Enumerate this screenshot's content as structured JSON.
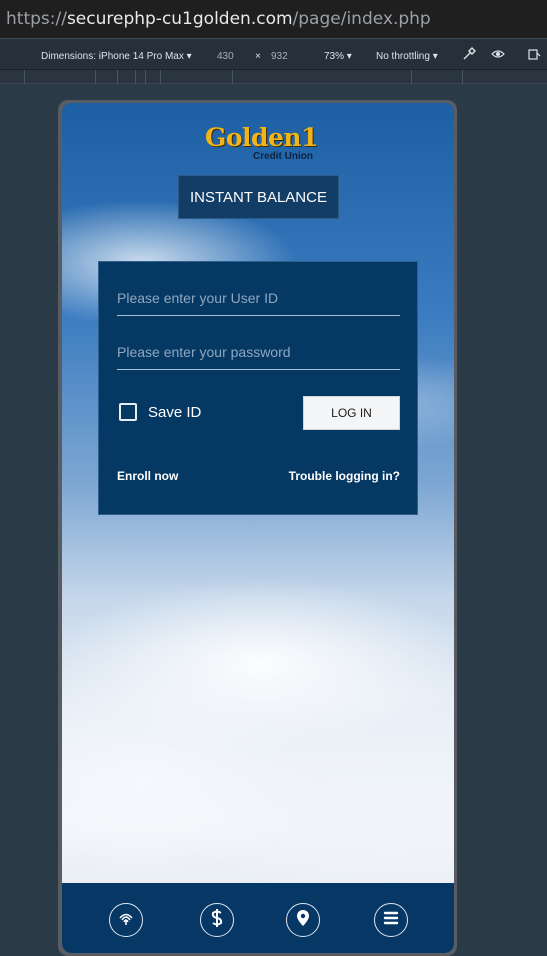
{
  "browser": {
    "url_scheme": "https://",
    "url_host": "securephp-cu1golden.com",
    "url_path": "/page/index.php"
  },
  "devtools": {
    "dimensions_label": "Dimensions: iPhone 14 Pro Max",
    "width": "430",
    "times": "×",
    "height": "932",
    "zoom": "73%",
    "throttling": "No throttling"
  },
  "header": {
    "logo_word": "Golden1",
    "logo_sub": "Credit Union",
    "instant_balance": "INSTANT BALANCE"
  },
  "login": {
    "user_placeholder": "Please enter your User ID",
    "password_placeholder": "Please enter your password",
    "save_id_label": "Save ID",
    "login_button": "LOG IN",
    "enroll_link": "Enroll now",
    "trouble_link": "Trouble logging in?"
  },
  "nav": {
    "items": [
      {
        "icon": "fingerprint-icon"
      },
      {
        "icon": "dollar-icon"
      },
      {
        "icon": "location-pin-icon"
      },
      {
        "icon": "menu-icon"
      }
    ]
  },
  "colors": {
    "panel": "#063864",
    "button": "#123d66",
    "logo": "#f2b418"
  }
}
